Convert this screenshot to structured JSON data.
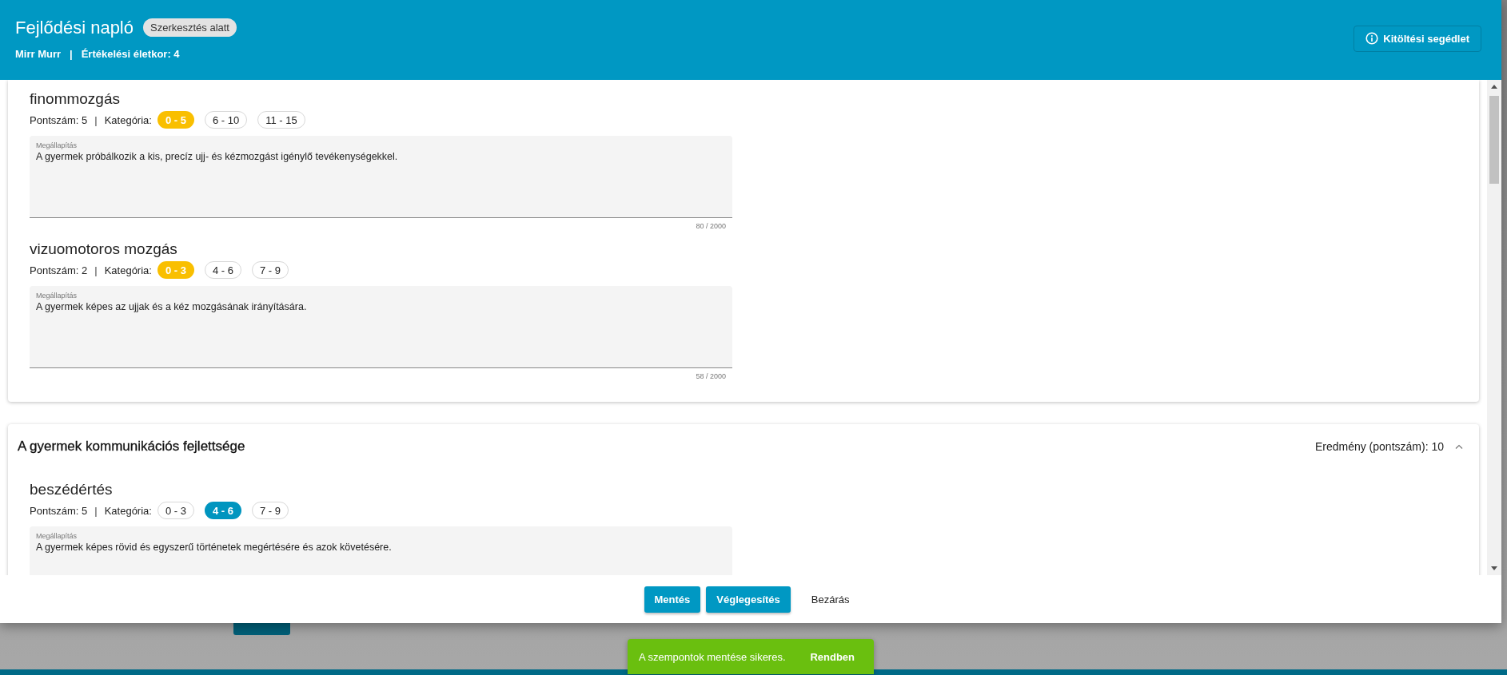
{
  "header": {
    "title": "Fejlődési napló",
    "status_badge": "Szerkesztés alatt",
    "student": "Mirr Murr",
    "separator": "|",
    "age": "Értékelési életkor: 4",
    "help_button": "Kitöltési segédlet"
  },
  "sections": [
    {
      "items": [
        {
          "name": "finommozgás",
          "score": "Pontszám: 5",
          "separator": "|",
          "category_label": "Kategória:",
          "color": "#f9bf00",
          "categories": [
            {
              "label": "0 - 5",
              "selected": true
            },
            {
              "label": "6 - 10",
              "selected": false
            },
            {
              "label": "11 - 15",
              "selected": false
            }
          ],
          "field": {
            "label": "Megállapítás",
            "value": "A gyermek próbálkozik a kis, precíz ujj- és kézmozgást igénylő tevékenységekkel.",
            "counter": "80 / 2000"
          }
        },
        {
          "name": "vizuomotoros mozgás",
          "score": "Pontszám: 2",
          "separator": "|",
          "category_label": "Kategória:",
          "color": "#f9bf00",
          "categories": [
            {
              "label": "0 - 3",
              "selected": true
            },
            {
              "label": "4 - 6",
              "selected": false
            },
            {
              "label": "7 - 9",
              "selected": false
            }
          ],
          "field": {
            "label": "Megállapítás",
            "value": "A gyermek képes az ujjak és a kéz mozgásának irányítására.",
            "counter": "58 / 2000"
          }
        }
      ]
    },
    {
      "title": "A gyermek kommunikációs fejlettsége",
      "result": "Eredmény (pontszám): 10",
      "expanded": true,
      "items": [
        {
          "name": "beszédértés",
          "score": "Pontszám: 5",
          "separator": "|",
          "category_label": "Kategória:",
          "color": "#0095bf",
          "categories": [
            {
              "label": "0 - 3",
              "selected": false
            },
            {
              "label": "4 - 6",
              "selected": true
            },
            {
              "label": "7 - 9",
              "selected": false
            }
          ],
          "field": {
            "label": "Megállapítás",
            "value": "A gyermek képes rövid és egyszerű történetek megértésére és azok követésére."
          }
        }
      ]
    }
  ],
  "dialog_buttons": [
    {
      "label": "Mentés",
      "kind": "primary"
    },
    {
      "label": "Véglegesítés",
      "kind": "primary"
    },
    {
      "label": "Bezárás",
      "kind": "text"
    }
  ],
  "snackbar": {
    "message": "A szempontok mentése sikeres.",
    "action": "Rendben"
  }
}
